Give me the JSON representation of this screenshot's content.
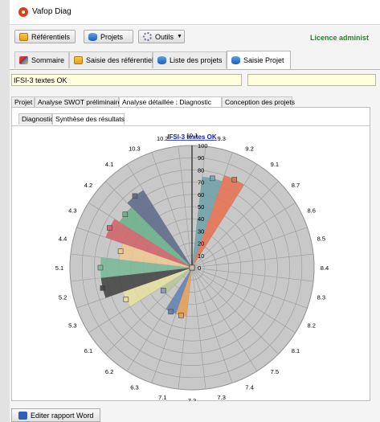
{
  "window": {
    "title": "Vafop Diag"
  },
  "toolbar": {
    "referentiels": "Référentiels",
    "projets": "Projets",
    "outils": "Outils",
    "outils_arrow": "▼",
    "licence": "Licence administ"
  },
  "main_tabs": [
    "Sommaire",
    "Saisie des référentiels",
    "Liste des projets",
    "Saisie Projet"
  ],
  "project_field": {
    "value": "IFSI-3 textes OK"
  },
  "analysis_tabs": [
    "Projet",
    "Analyse SWOT préliminaire",
    "Analyse détaillée : Diagnostic",
    "Conception des projets"
  ],
  "diagnostic_tabs": [
    "Diagnostic",
    "Synthèse des résultats"
  ],
  "footer": {
    "word_button": "Editer rapport Word"
  },
  "chart_data": {
    "type": "polar-area",
    "title": "IFSI-3 textes OK",
    "categories": [
      "10.1",
      "9.3",
      "9.2",
      "9.1",
      "8.7",
      "8.6",
      "8.5",
      "8.4",
      "8.3",
      "8.2",
      "8.1",
      "7.5",
      "7.4",
      "7.3",
      "7.2",
      "7.1",
      "6.3",
      "6.2",
      "6.1",
      "5.3",
      "5.2",
      "5.1",
      "4.4",
      "4.3",
      "4.2",
      "4.1",
      "10.3",
      "10.2"
    ],
    "values": [
      0,
      75,
      80,
      0,
      0,
      0,
      0,
      0,
      0,
      0,
      0,
      0,
      0,
      0,
      0,
      40,
      40,
      0,
      30,
      60,
      75,
      75,
      60,
      75,
      70,
      75,
      0,
      0
    ],
    "colors": [
      "#7fa0b0",
      "#6fa0a8",
      "#e87050",
      "#7fa0b0",
      "#7fa0b0",
      "#7fa0b0",
      "#7fa0b0",
      "#7fa0b0",
      "#7fa0b0",
      "#7fa0b0",
      "#7fa0b0",
      "#7fa0b0",
      "#7fa0b0",
      "#7fa0b0",
      "#e8a050",
      "#e8a050",
      "#5f7fb0",
      "#7fa0b0",
      "#b8c898",
      "#e8e0a0",
      "#404040",
      "#78b898",
      "#f0c890",
      "#d06068",
      "#68b088",
      "#5a6888",
      "#7fa0b0",
      "#7fa0b0"
    ],
    "marker_colors": [
      "#7f98c0",
      "#70a8b0",
      "#e07050",
      "#d0c0a0",
      "#d0c0a0",
      "#d0c0a0",
      "#d0c0a0",
      "#d0c0a0",
      "#d0c0a0",
      "#d0c0a0",
      "#d0c0a0",
      "#d0c0a0",
      "#d0c0a0",
      "#d0c0a0",
      "#e07040",
      "#e0a050",
      "#5f7fb0",
      "#d0c0a0",
      "#7f98c0",
      "#e8e0a0",
      "#404040",
      "#78b898",
      "#f0c890",
      "#d06068",
      "#68b088",
      "#5a6888",
      "#d0c0a0",
      "#d0c0a0"
    ],
    "radial_ticks": [
      "0",
      "10",
      "20",
      "30",
      "40",
      "50",
      "60",
      "70",
      "80",
      "90",
      "100"
    ],
    "rmax": 100
  }
}
